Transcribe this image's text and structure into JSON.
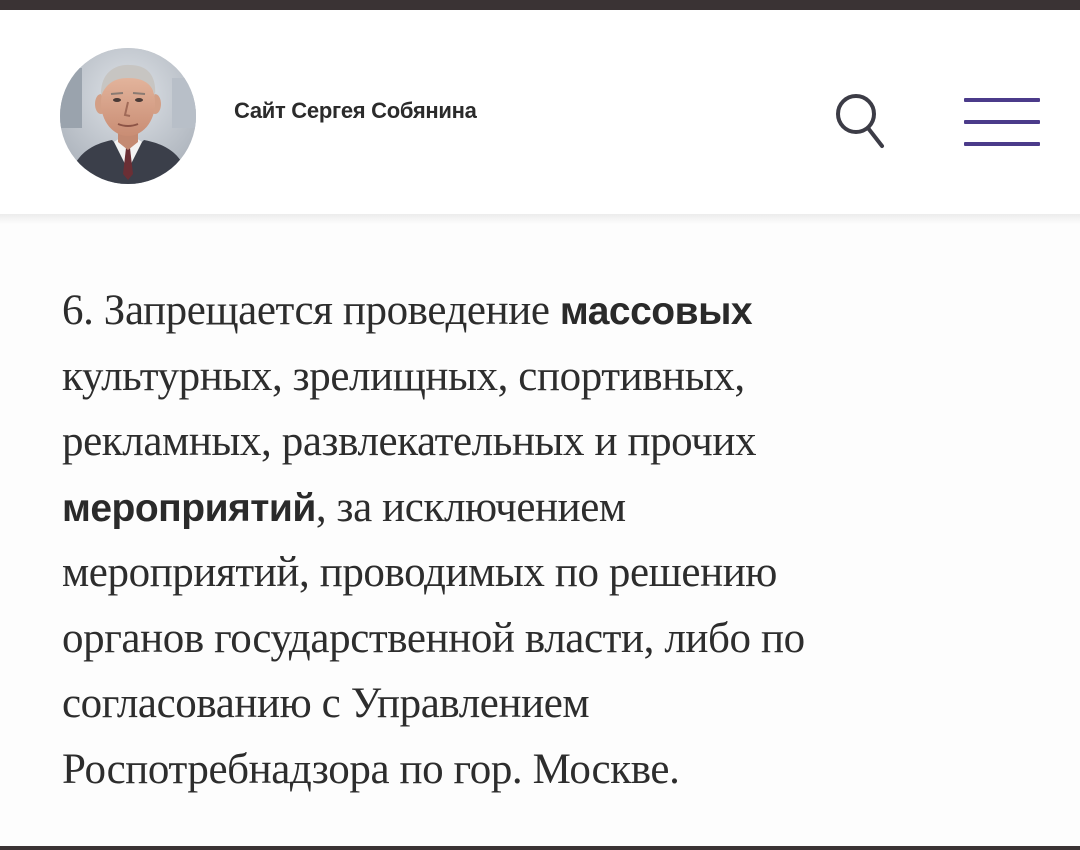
{
  "header": {
    "site_title": "Сайт Сергея Собянина",
    "avatar_icon": "portrait-photo",
    "search_icon": "search-icon",
    "menu_icon": "hamburger-menu-icon",
    "accent_color": "#4b3b8a"
  },
  "article": {
    "lines": [
      [
        {
          "text": "6. Запрещается проведение ",
          "bold": false
        },
        {
          "text": "массовых",
          "bold": true
        }
      ],
      [
        {
          "text": "культурных, зрелищных, спортивных,",
          "bold": false
        }
      ],
      [
        {
          "text": "рекламных, развлекательных и прочих",
          "bold": false
        }
      ],
      [
        {
          "text": "мероприятий",
          "bold": true
        },
        {
          "text": ", за исключением",
          "bold": false
        }
      ],
      [
        {
          "text": "мероприятий, проводимых по решению",
          "bold": false
        }
      ],
      [
        {
          "text": "органов государственной власти, либо по",
          "bold": false
        }
      ],
      [
        {
          "text": "согласованию с Управлением",
          "bold": false
        }
      ],
      [
        {
          "text": "Роспотребнадзора по гор. Москве.",
          "bold": false
        }
      ]
    ]
  }
}
